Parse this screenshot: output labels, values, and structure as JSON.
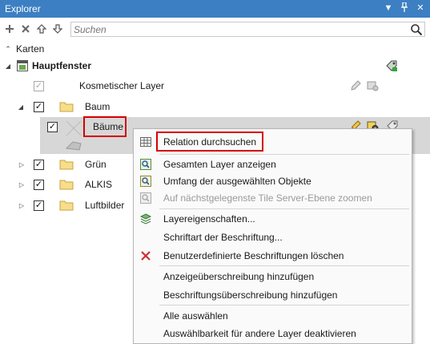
{
  "window": {
    "title": "Explorer"
  },
  "toolbar": {
    "search_placeholder": "Suchen"
  },
  "tree": {
    "root_label": "Karten",
    "map_label": "Hauptfenster",
    "items": {
      "cosmetic": "Kosmetischer Layer",
      "baum": "Baum",
      "baeume": "Bäume",
      "gruen": "Grün",
      "alkis": "ALKIS",
      "luftbilder": "Luftbilder"
    }
  },
  "context_menu": {
    "relation": "Relation durchsuchen",
    "show_all": "Gesamten Layer anzeigen",
    "extent_selected": "Umfang der ausgewählten Objekte",
    "zoom_tile": "Auf nächstgelegenste Tile Server-Ebene zoomen",
    "layer_props": "Layereigenschaften...",
    "label_font": "Schriftart der Beschriftung...",
    "delete_custom_labels": "Benutzerdefinierte Beschriftungen löschen",
    "add_display_override": "Anzeigeüberschreibung hinzufügen",
    "add_label_override": "Beschriftungsüberschreibung hinzufügen",
    "select_all": "Alle auswählen",
    "disable_selectability": "Auswählbarkeit für andere Layer deaktivieren"
  },
  "colors": {
    "titlebar": "#3c7fc3",
    "highlight": "#d40000",
    "selection": "#d7d7d7"
  }
}
